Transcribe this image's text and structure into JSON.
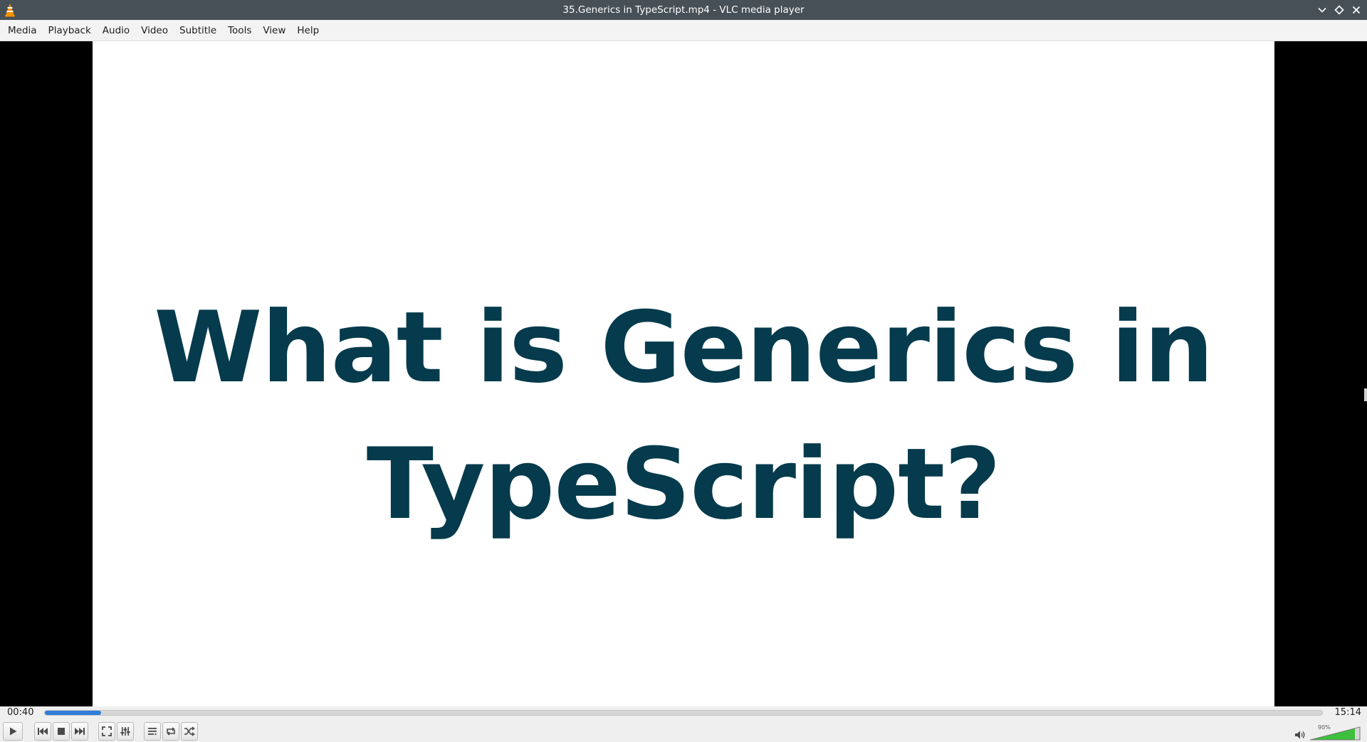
{
  "window": {
    "title": "35.Generics in TypeScript.mp4 - VLC media player"
  },
  "menu": {
    "items": [
      "Media",
      "Playback",
      "Audio",
      "Video",
      "Subtitle",
      "Tools",
      "View",
      "Help"
    ]
  },
  "video": {
    "slide_line1": "What is Generics in",
    "slide_line2": "TypeScript?",
    "text_color": "#053b4c"
  },
  "playback": {
    "elapsed": "00:40",
    "total": "15:14",
    "progress_fraction": 0.044
  },
  "volume": {
    "label": "90%",
    "level_fraction": 0.9
  },
  "colors": {
    "accent": "#2f7ed8",
    "volume_green": "#3cbf3c",
    "titlebar": "#475057"
  },
  "icons": {
    "app": "vlc-cone-icon",
    "minimize": "chevron-down-icon",
    "maximize": "diamond-icon",
    "close": "close-icon",
    "play": "play-icon",
    "previous": "skip-previous-icon",
    "stop": "stop-icon",
    "next": "skip-next-icon",
    "fullscreen": "fullscreen-icon",
    "extended": "equalizer-icon",
    "playlist": "playlist-icon",
    "loop": "loop-icon",
    "random": "shuffle-icon",
    "volume": "speaker-icon"
  }
}
